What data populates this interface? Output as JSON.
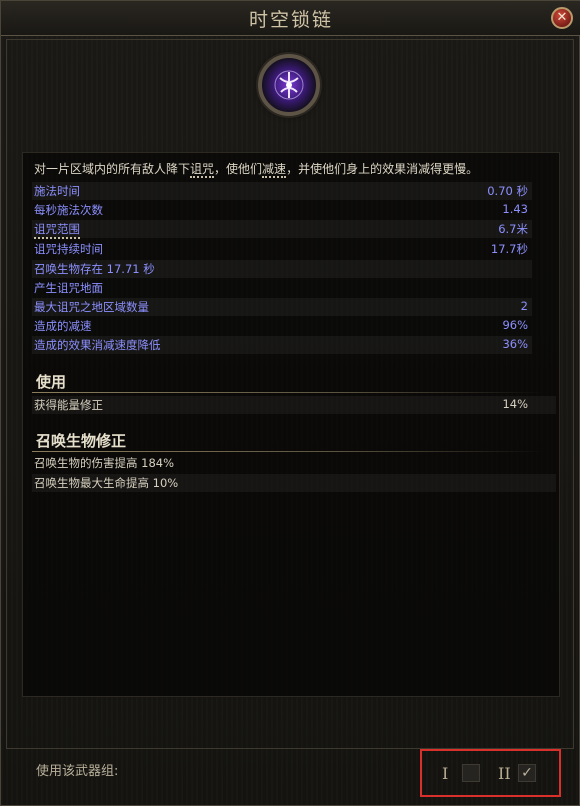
{
  "window": {
    "title": "时空锁链",
    "close_glyph": "✕"
  },
  "skill": {
    "icon": "purple-rune-orb-icon"
  },
  "description": {
    "part1": "对一片区域内的所有敌人降下",
    "kw1": "诅咒",
    "part2": "，使他们",
    "kw2": "减速",
    "part3": "，并使他们身上的效果消减得更慢。"
  },
  "stats": [
    {
      "label": "施法时间",
      "value": "0.70 秒"
    },
    {
      "label": "每秒施法次数",
      "value": "1.43"
    },
    {
      "label": "诅咒范围",
      "value": "6.7米"
    },
    {
      "label": "诅咒持续时间",
      "value": "17.7秒"
    },
    {
      "label": "召唤生物存在 17.71 秒",
      "value": ""
    },
    {
      "label": "产生诅咒地面",
      "value": ""
    },
    {
      "label": "最大诅咒之地区域数量",
      "value": "2"
    },
    {
      "label": "造成的减速",
      "value": "96%"
    },
    {
      "label": "造成的效果消减速度降低",
      "value": "36%"
    }
  ],
  "usage": {
    "title": "使用",
    "rows": [
      {
        "label": "获得能量修正",
        "value": "14%"
      }
    ]
  },
  "minion": {
    "title": "召唤生物修正",
    "rows": [
      {
        "label": "召唤生物的伤害提高 184%"
      },
      {
        "label": "召唤生物最大生命提高 10%"
      }
    ]
  },
  "footer": {
    "weapon_set_label": "使用该武器组:",
    "set1": {
      "label": "I",
      "checked": false
    },
    "set2": {
      "label": "II",
      "checked": true,
      "check_glyph": "✓"
    }
  },
  "colors": {
    "stat_blue": "#8c90ff",
    "accent_red": "#d9302c"
  }
}
